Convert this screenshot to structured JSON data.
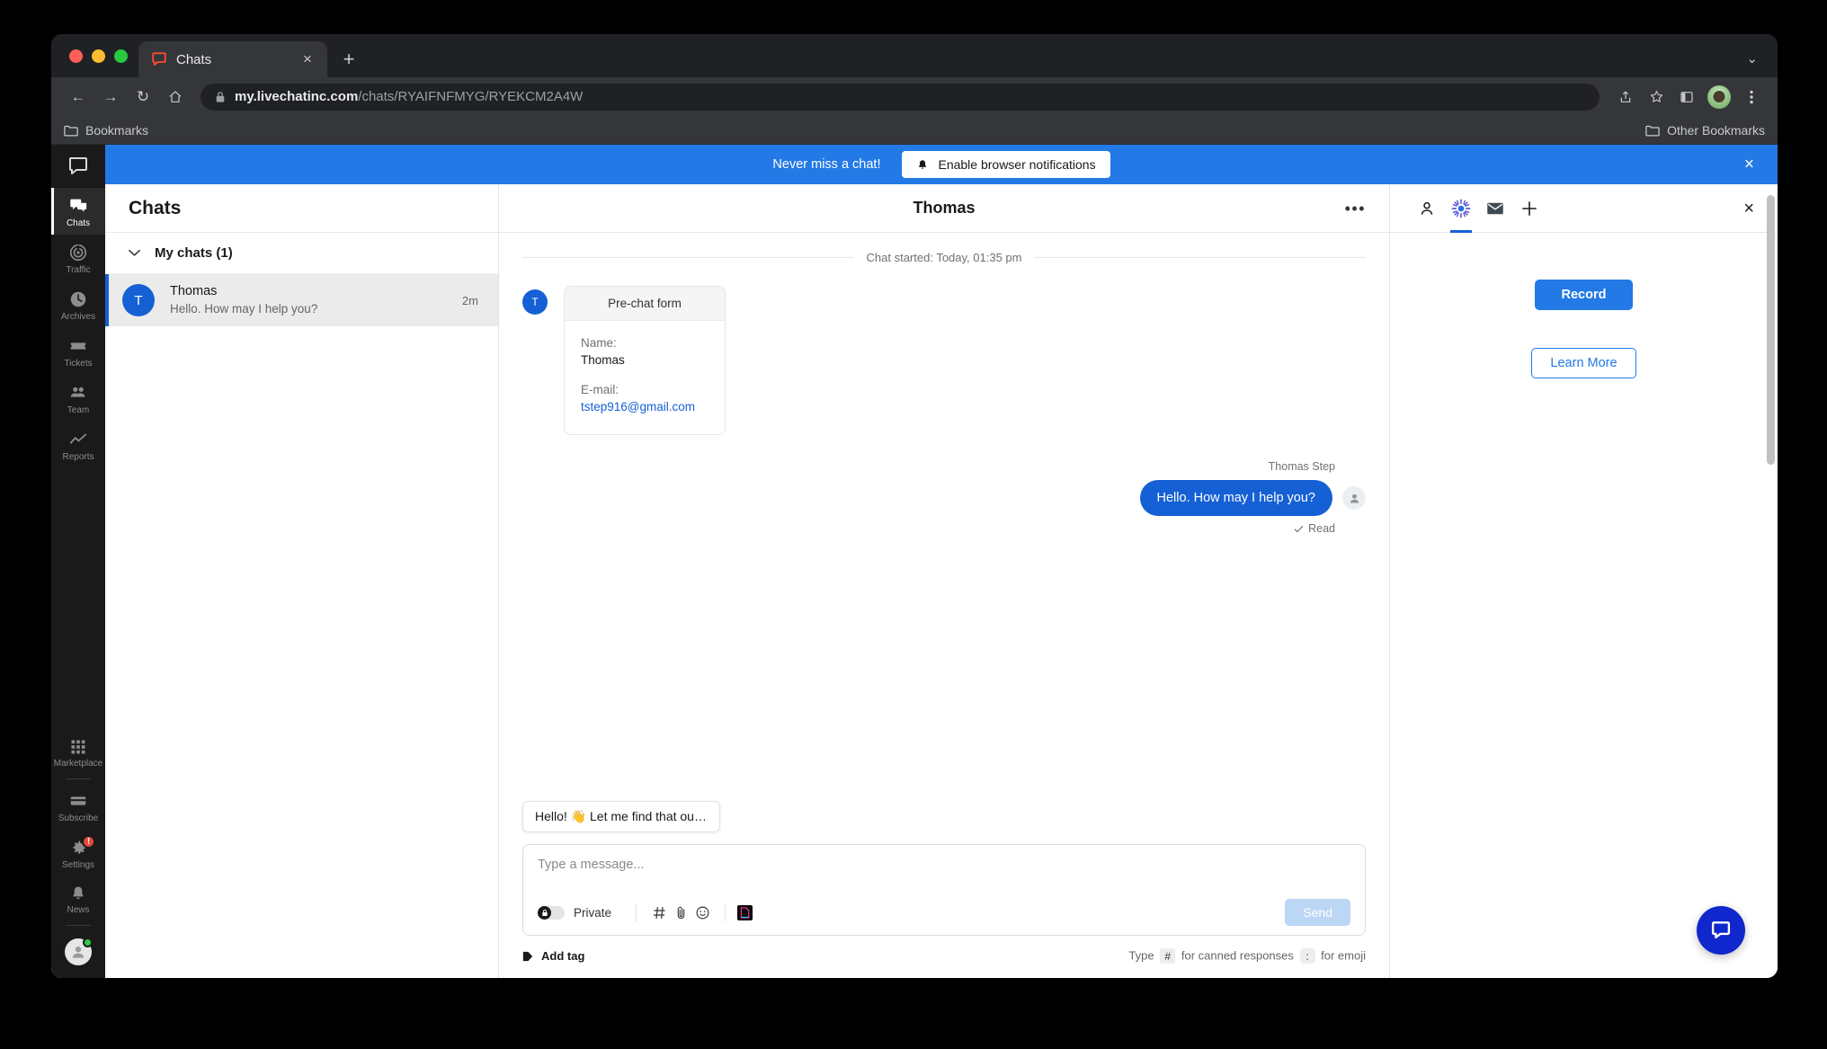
{
  "browser": {
    "tab": {
      "title": "Chats",
      "favicon": "livechat-icon",
      "close": "×"
    },
    "new_tab_label": "+",
    "tabstrip_chevron": "⌄",
    "nav": {
      "back": "←",
      "forward": "→",
      "reload": "↻",
      "home": "⌂"
    },
    "omnibox": {
      "host": "my.livechatinc.com",
      "path": "/chats/RYAIFNFMYG/RYEKCM2A4W",
      "lock": "lock-icon"
    },
    "toolbar_icons": [
      "share-icon",
      "bookmark-star-icon",
      "side-panel-icon",
      "profile-avatar",
      "chrome-menu-icon"
    ],
    "bookmarks": {
      "label": "Bookmarks",
      "other_label": "Other Bookmarks"
    }
  },
  "sidebar": {
    "logo": "livechat-logo",
    "items": [
      {
        "label": "Chats",
        "icon": "chats-icon",
        "active": true
      },
      {
        "label": "Traffic",
        "icon": "traffic-icon",
        "active": false
      },
      {
        "label": "Archives",
        "icon": "archives-clock-icon",
        "active": false
      },
      {
        "label": "Tickets",
        "icon": "tickets-icon",
        "active": false
      },
      {
        "label": "Team",
        "icon": "team-icon",
        "active": false
      },
      {
        "label": "Reports",
        "icon": "reports-chart-icon",
        "active": false
      }
    ],
    "bottom_items": [
      {
        "label": "Marketplace",
        "icon": "grid-icon",
        "badge": ""
      },
      {
        "label": "Subscribe",
        "icon": "credit-card-icon",
        "badge": ""
      },
      {
        "label": "Settings",
        "icon": "gear-icon",
        "badge": "!"
      },
      {
        "label": "News",
        "icon": "bell-icon",
        "badge": ""
      }
    ],
    "account": {
      "icon": "user-avatar",
      "status": "online"
    }
  },
  "banner": {
    "text": "Never miss a chat!",
    "button_label": "Enable browser notifications",
    "button_icon": "bell-icon",
    "close": "×",
    "color": "#2379e6"
  },
  "chat_list": {
    "title": "Chats",
    "group_label": "My chats (1)",
    "group_chevron": "chevron-down-icon",
    "rows": [
      {
        "initial": "T",
        "name": "Thomas",
        "preview": "Hello. How may I help you?",
        "time": "2m"
      }
    ]
  },
  "conversation": {
    "title": "Thomas",
    "more": "•••",
    "started": "Chat started: Today, 01:35 pm",
    "prechat": {
      "avatar_initial": "T",
      "header": "Pre-chat form",
      "name_label": "Name:",
      "name_value": "Thomas",
      "email_label": "E-mail:",
      "email_value": "tstep916@gmail.com"
    },
    "agent_message": {
      "author": "Thomas Step",
      "text": "Hello. How may I help you?",
      "status": "Read",
      "status_icon": "check-icon",
      "bubble_color": "#1560d4"
    },
    "composer": {
      "suggestion": "Hello! 👋 Let me find that out f…",
      "placeholder": "Type a message...",
      "private_label": "Private",
      "private_icon": "lock-icon",
      "tools": [
        "hash-icon",
        "attachment-icon",
        "emoji-icon",
        "app-icon"
      ],
      "send_label": "Send"
    },
    "footer": {
      "add_tag": "Add tag",
      "add_tag_icon": "tag-icon",
      "hint_prefix": "Type",
      "hint_key_hash": "#",
      "hint_middle": "for canned responses",
      "hint_key_colon": ":",
      "hint_suffix": "for emoji"
    }
  },
  "details_panel": {
    "tabs": [
      {
        "icon": "person-icon",
        "active": false
      },
      {
        "icon": "sun-burst-icon",
        "active": true
      },
      {
        "icon": "mail-icon",
        "active": false
      },
      {
        "icon": "plus-icon",
        "active": false
      }
    ],
    "close": "×",
    "record_label": "Record",
    "learn_more_label": "Learn More",
    "accent": "#2379e6"
  },
  "widget": {
    "icon": "livechat-bubble-icon",
    "color": "#0f27cc"
  }
}
